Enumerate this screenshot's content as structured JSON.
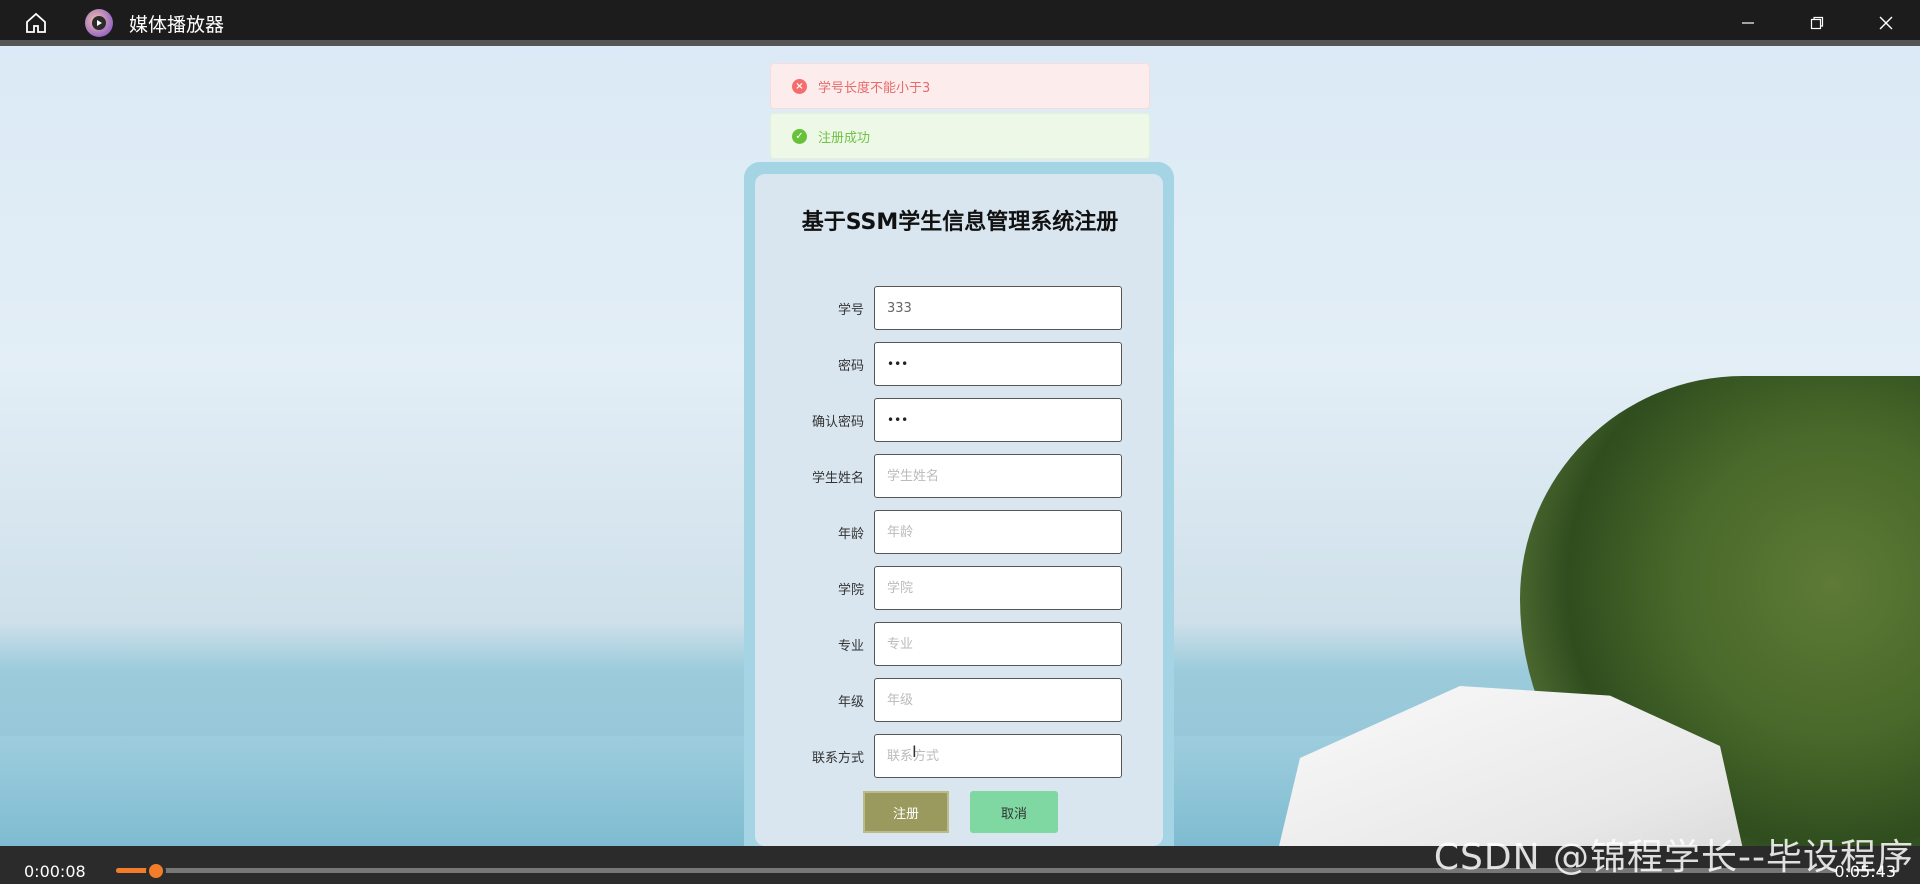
{
  "app": {
    "title": "媒体播放器"
  },
  "messages": {
    "error": "学号长度不能小于3",
    "success": "注册成功"
  },
  "form": {
    "title": "基于SSM学生信息管理系统注册",
    "fields": [
      {
        "label": "学号",
        "value": "333",
        "placeholder": ""
      },
      {
        "label": "密码",
        "value": "•••",
        "placeholder": ""
      },
      {
        "label": "确认密码",
        "value": "•••",
        "placeholder": ""
      },
      {
        "label": "学生姓名",
        "value": "",
        "placeholder": "学生姓名"
      },
      {
        "label": "年龄",
        "value": "",
        "placeholder": "年龄"
      },
      {
        "label": "学院",
        "value": "",
        "placeholder": "学院"
      },
      {
        "label": "专业",
        "value": "",
        "placeholder": "专业"
      },
      {
        "label": "年级",
        "value": "",
        "placeholder": "年级"
      },
      {
        "label": "联系方式",
        "value": "",
        "placeholder": "联系方式"
      }
    ],
    "register_label": "注册",
    "cancel_label": "取消"
  },
  "player": {
    "current_time": "0:00:08",
    "total_time": "0:05:43",
    "progress": 0.023
  },
  "watermark": "CSDN @锦程学长--毕设程序"
}
